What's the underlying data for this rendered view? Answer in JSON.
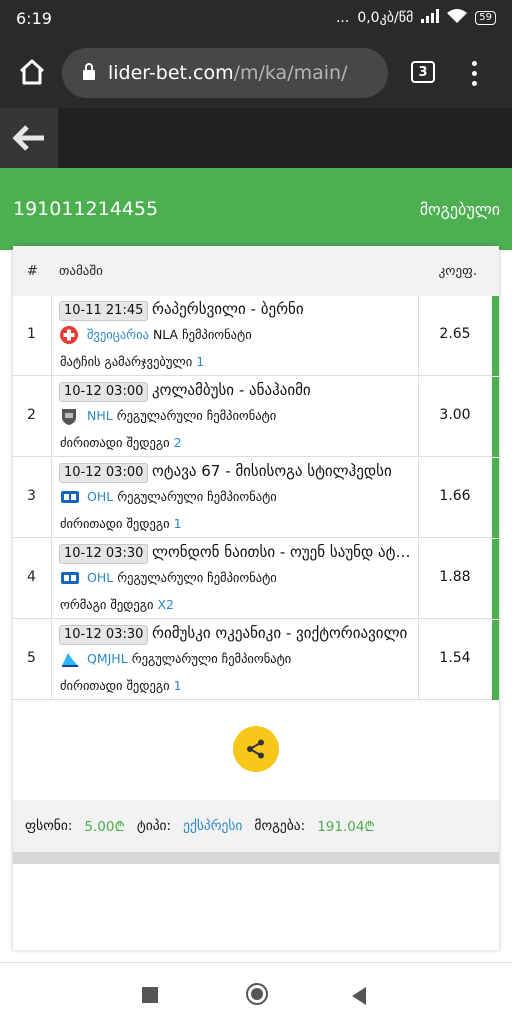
{
  "status_bar": {
    "time": "6:19",
    "dots": "...",
    "network": "0,0კბ/წმ",
    "battery": "59"
  },
  "browser": {
    "url_host": "lider-bet.com",
    "url_path": "/m/ka/main/",
    "tab_count": "3"
  },
  "ticket": {
    "id": "191011214455",
    "status": "მოგებული"
  },
  "table": {
    "headers": {
      "num": "#",
      "game": "თამაში",
      "odds": "კოეფ."
    },
    "rows": [
      {
        "num": "1",
        "time": "10-11 21:45",
        "teams": "რაპერსვილი - ბერნი",
        "country": "შვეიცარია",
        "league": "NLA ჩემპიონატი",
        "market": "მატჩის გამარჯვებული",
        "pick": "1",
        "odds": "2.65",
        "icon": "swiss-flag-icon"
      },
      {
        "num": "2",
        "time": "10-12 03:00",
        "teams": "კოლამბუსი - ანაჰაიმი",
        "country": "NHL",
        "league": "რეგულარული ჩემპიონატი",
        "market": "ძირითადი შედეგი",
        "pick": "2",
        "odds": "3.00",
        "icon": "nhl-icon"
      },
      {
        "num": "3",
        "time": "10-12 03:00",
        "teams": "ოტავა 67 - მისისოგა სტილჰედსი",
        "country": "OHL",
        "league": "რეგულარული ჩემპიონატი",
        "market": "ძირითადი შედეგი",
        "pick": "1",
        "odds": "1.66",
        "icon": "ohl-icon"
      },
      {
        "num": "4",
        "time": "10-12 03:30",
        "teams": "ლონდონ ნაითსი - ოუენ საუნდ ატაკი",
        "country": "OHL",
        "league": "რეგულარული ჩემპიონატი",
        "market": "ორმაგი შედეგი",
        "pick": "X2",
        "odds": "1.88",
        "icon": "ohl-icon"
      },
      {
        "num": "5",
        "time": "10-12 03:30",
        "teams": "რიმუსკი ოკეანიკი - ვიქტორიავილი",
        "country": "QMJHL",
        "league": "რეგულარული ჩემპიონატი",
        "market": "ძირითადი შედეგი",
        "pick": "1",
        "odds": "1.54",
        "icon": "qmjhl-icon"
      }
    ]
  },
  "summary": {
    "stake_label": "ფსონი:",
    "stake_value": "5.00₾",
    "type_label": "ტიპი:",
    "type_value": "ექსპრესი",
    "win_label": "მოგება:",
    "win_value": "191.04₾"
  },
  "colors": {
    "green": "#4caf50",
    "blue": "#2a88c8",
    "share": "#f9c61a",
    "dark": "#2a2a2a"
  }
}
